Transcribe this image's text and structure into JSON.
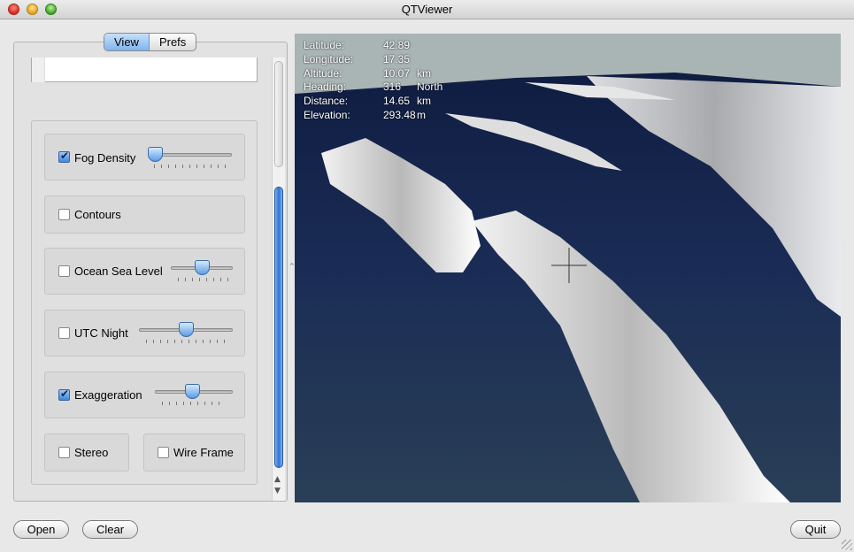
{
  "window": {
    "title": "QTViewer"
  },
  "tabs": [
    {
      "label": "View",
      "active": true
    },
    {
      "label": "Prefs",
      "active": false
    }
  ],
  "controls": {
    "fog_density": {
      "label": "Fog Density",
      "checked": true,
      "slider_value": 0.05
    },
    "contours": {
      "label": "Contours",
      "checked": false
    },
    "ocean_sea_level": {
      "label": "Ocean Sea Level",
      "checked": false,
      "slider_value": 0.5
    },
    "utc_night": {
      "label": "UTC Night",
      "checked": false,
      "slider_value": 0.5
    },
    "exaggeration": {
      "label": "Exaggeration",
      "checked": true,
      "slider_value": 0.5
    },
    "stereo": {
      "label": "Stereo",
      "checked": false
    },
    "wire_frame": {
      "label": "Wire Frame",
      "checked": false
    }
  },
  "hud": {
    "latitude": {
      "label": "Latitude:",
      "value": "42.89",
      "unit": ""
    },
    "longitude": {
      "label": "Longitude:",
      "value": "17.35",
      "unit": ""
    },
    "altitude": {
      "label": "Altitude:",
      "value": "10.07",
      "unit": "km"
    },
    "heading": {
      "label": "Heading:",
      "value": "316",
      "unit": "North"
    },
    "distance": {
      "label": "Distance:",
      "value": "14.65",
      "unit": "km"
    },
    "elevation": {
      "label": "Elevation:",
      "value": "293.48",
      "unit": "m"
    }
  },
  "buttons": {
    "open": "Open",
    "clear": "Clear",
    "quit": "Quit"
  },
  "colors": {
    "accent": "#3f88db",
    "ocean": "#1b2b4e",
    "sky": "#a9b4b4"
  }
}
